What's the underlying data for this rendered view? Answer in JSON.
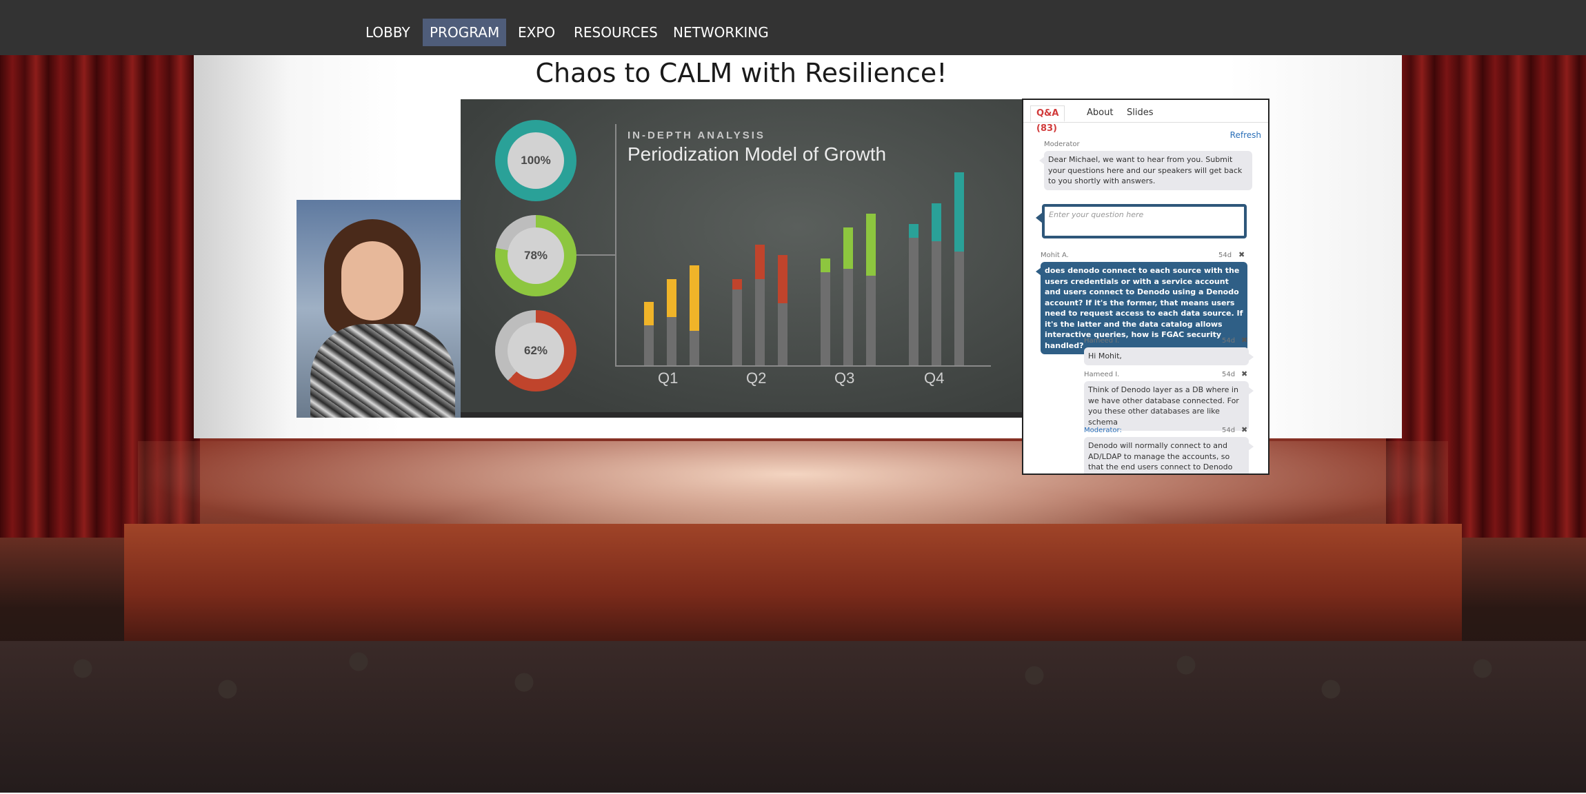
{
  "nav": {
    "items": [
      {
        "label": "LOBBY",
        "active": false
      },
      {
        "label": "PROGRAM",
        "active": true
      },
      {
        "label": "EXPO",
        "active": false
      },
      {
        "label": "RESOURCES",
        "active": false
      },
      {
        "label": "NETWORKING",
        "active": false
      }
    ]
  },
  "session": {
    "title": "Chaos to CALM with Resilience!"
  },
  "slide": {
    "kicker": "IN-DEPTH ANALYSIS",
    "title": "Periodization Model of Growth",
    "donuts": [
      {
        "label": "100%",
        "value": 1.0,
        "color": "#2aa198"
      },
      {
        "label": "78%",
        "value": 0.78,
        "color": "#8dc63f"
      },
      {
        "label": "62%",
        "value": 0.62,
        "color": "#c0442c"
      }
    ],
    "quarters": [
      "Q1",
      "Q2",
      "Q3",
      "Q4"
    ],
    "quarter_colors": [
      "#f0b429",
      "#c0442c",
      "#8dc63f",
      "#2aa198"
    ]
  },
  "qa": {
    "tabs": [
      {
        "label": "Q&A (83)",
        "active": true
      },
      {
        "label": "About",
        "active": false
      },
      {
        "label": "Slides",
        "active": false
      }
    ],
    "refresh_label": "Refresh",
    "moderator_label": "Moderator",
    "moderator_msg": "Dear Michael, we want to hear from you. Submit your questions here and our speakers will get back to you shortly with answers.",
    "input_placeholder": "Enter your question here",
    "messages": [
      {
        "author": "Mohit A.",
        "time": "54d",
        "text": "does denodo connect to each source with the users credentials or with a service account and users connect to Denodo using a Denodo account? If it's the former, that means users need to request access to each data source. If it's the latter and the data catalog allows interactive queries, how is FGAC security handled?"
      },
      {
        "author": "Hameed I.",
        "time": "54d",
        "text": "Hi Mohit,"
      },
      {
        "author": "Hameed I.",
        "time": "54d",
        "text": "Think of Denodo layer as a DB where in we have other database connected. For you these other databases are like schema"
      },
      {
        "author": "Moderator:",
        "time": "54d",
        "text": "Denodo will normally connect to and AD/LDAP to manage the accounts, so that the end users connect to Denodo with their"
      }
    ]
  }
}
